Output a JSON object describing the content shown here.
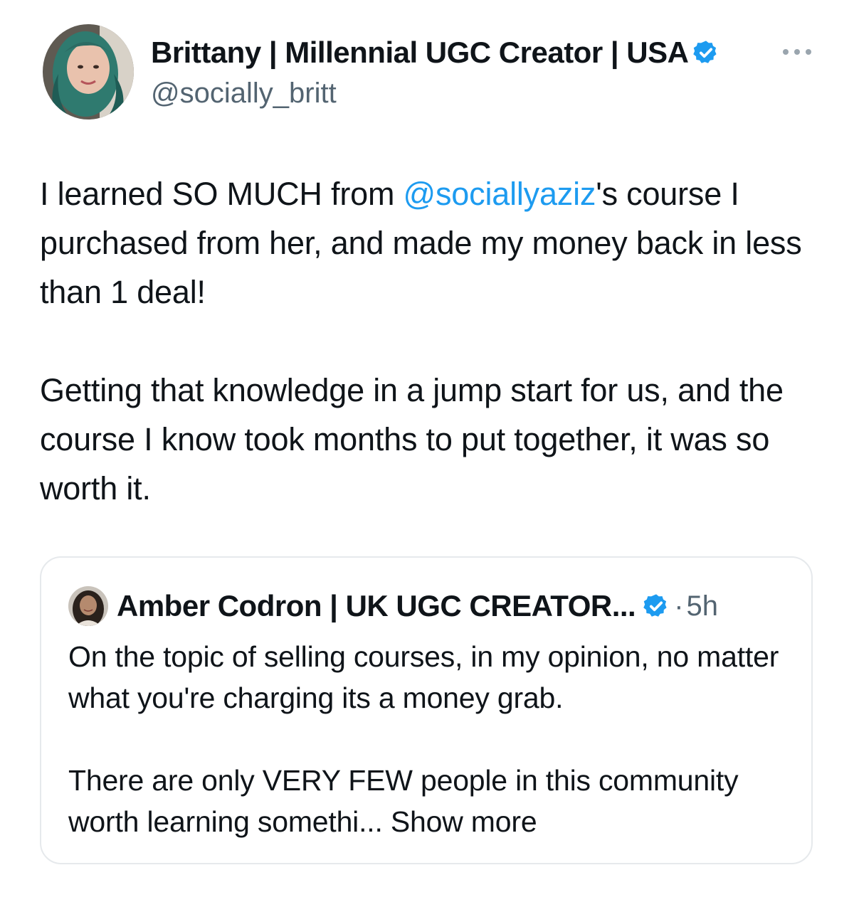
{
  "tweet": {
    "author": {
      "display_name": "Brittany | Millennial UGC Creator | USA",
      "handle": "@socially_britt",
      "verified": true
    },
    "more_icon": "ellipsis-icon",
    "body": {
      "p1_before": "I learned SO MUCH from ",
      "p1_mention": "@sociallyaziz",
      "p1_after": "'s course I purchased from her, and made my money back in less than 1 deal!",
      "p2": "Getting that knowledge in a jump start for us, and the course I know took months to put together, it was so worth it."
    }
  },
  "quoted_tweet": {
    "author": {
      "display_name": "Amber Codron | UK UGC CREATOR...",
      "verified": true
    },
    "separator": "·",
    "time": "5h",
    "p1": "On the topic of selling courses, in my opinion, no matter what you're charging its a money grab.",
    "p2": "There are only VERY FEW people in this community worth learning somethi...",
    "show_more": "Show more"
  },
  "colors": {
    "link": "#1d9bf0",
    "verified": "#1d9bf0",
    "secondary_text": "#536471",
    "border": "#e6e9ec"
  }
}
